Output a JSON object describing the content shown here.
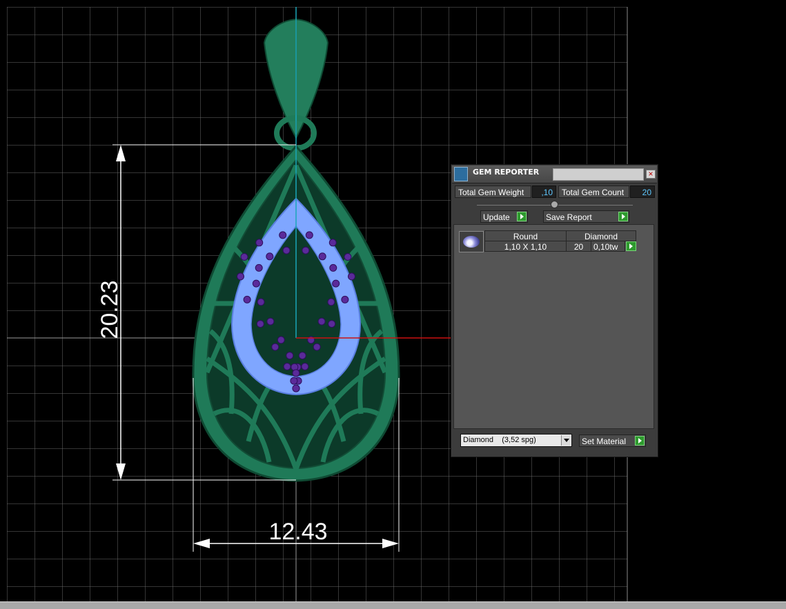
{
  "dimensions": {
    "height": "20.23",
    "width": "12.43"
  },
  "gem_reporter": {
    "title": "GEM REPORTER",
    "close_label": "×",
    "total_weight_label": "Total Gem Weight",
    "total_weight_value": ",10",
    "total_count_label": "Total Gem Count",
    "total_count_value": "20",
    "update_label": "Update",
    "save_label": "Save Report",
    "gems": [
      {
        "shape": "Round",
        "type": "Diamond",
        "size": "1,10 X 1,10",
        "count": "20",
        "weight": "0,10tw"
      }
    ],
    "material_selected": "Diamond    (3,52 spg)",
    "set_material_label": "Set Material"
  },
  "colors": {
    "background": "#000000",
    "grid": "#6a6a6a",
    "pendant": "#1f7a58",
    "gem_band": "#7fa6ff",
    "gem": "#5a2a9a",
    "dimension": "#ffffff",
    "axis_x": "#cc1111",
    "axis_y": "#1aa6b8",
    "accent_button": "#2e9a2e"
  }
}
